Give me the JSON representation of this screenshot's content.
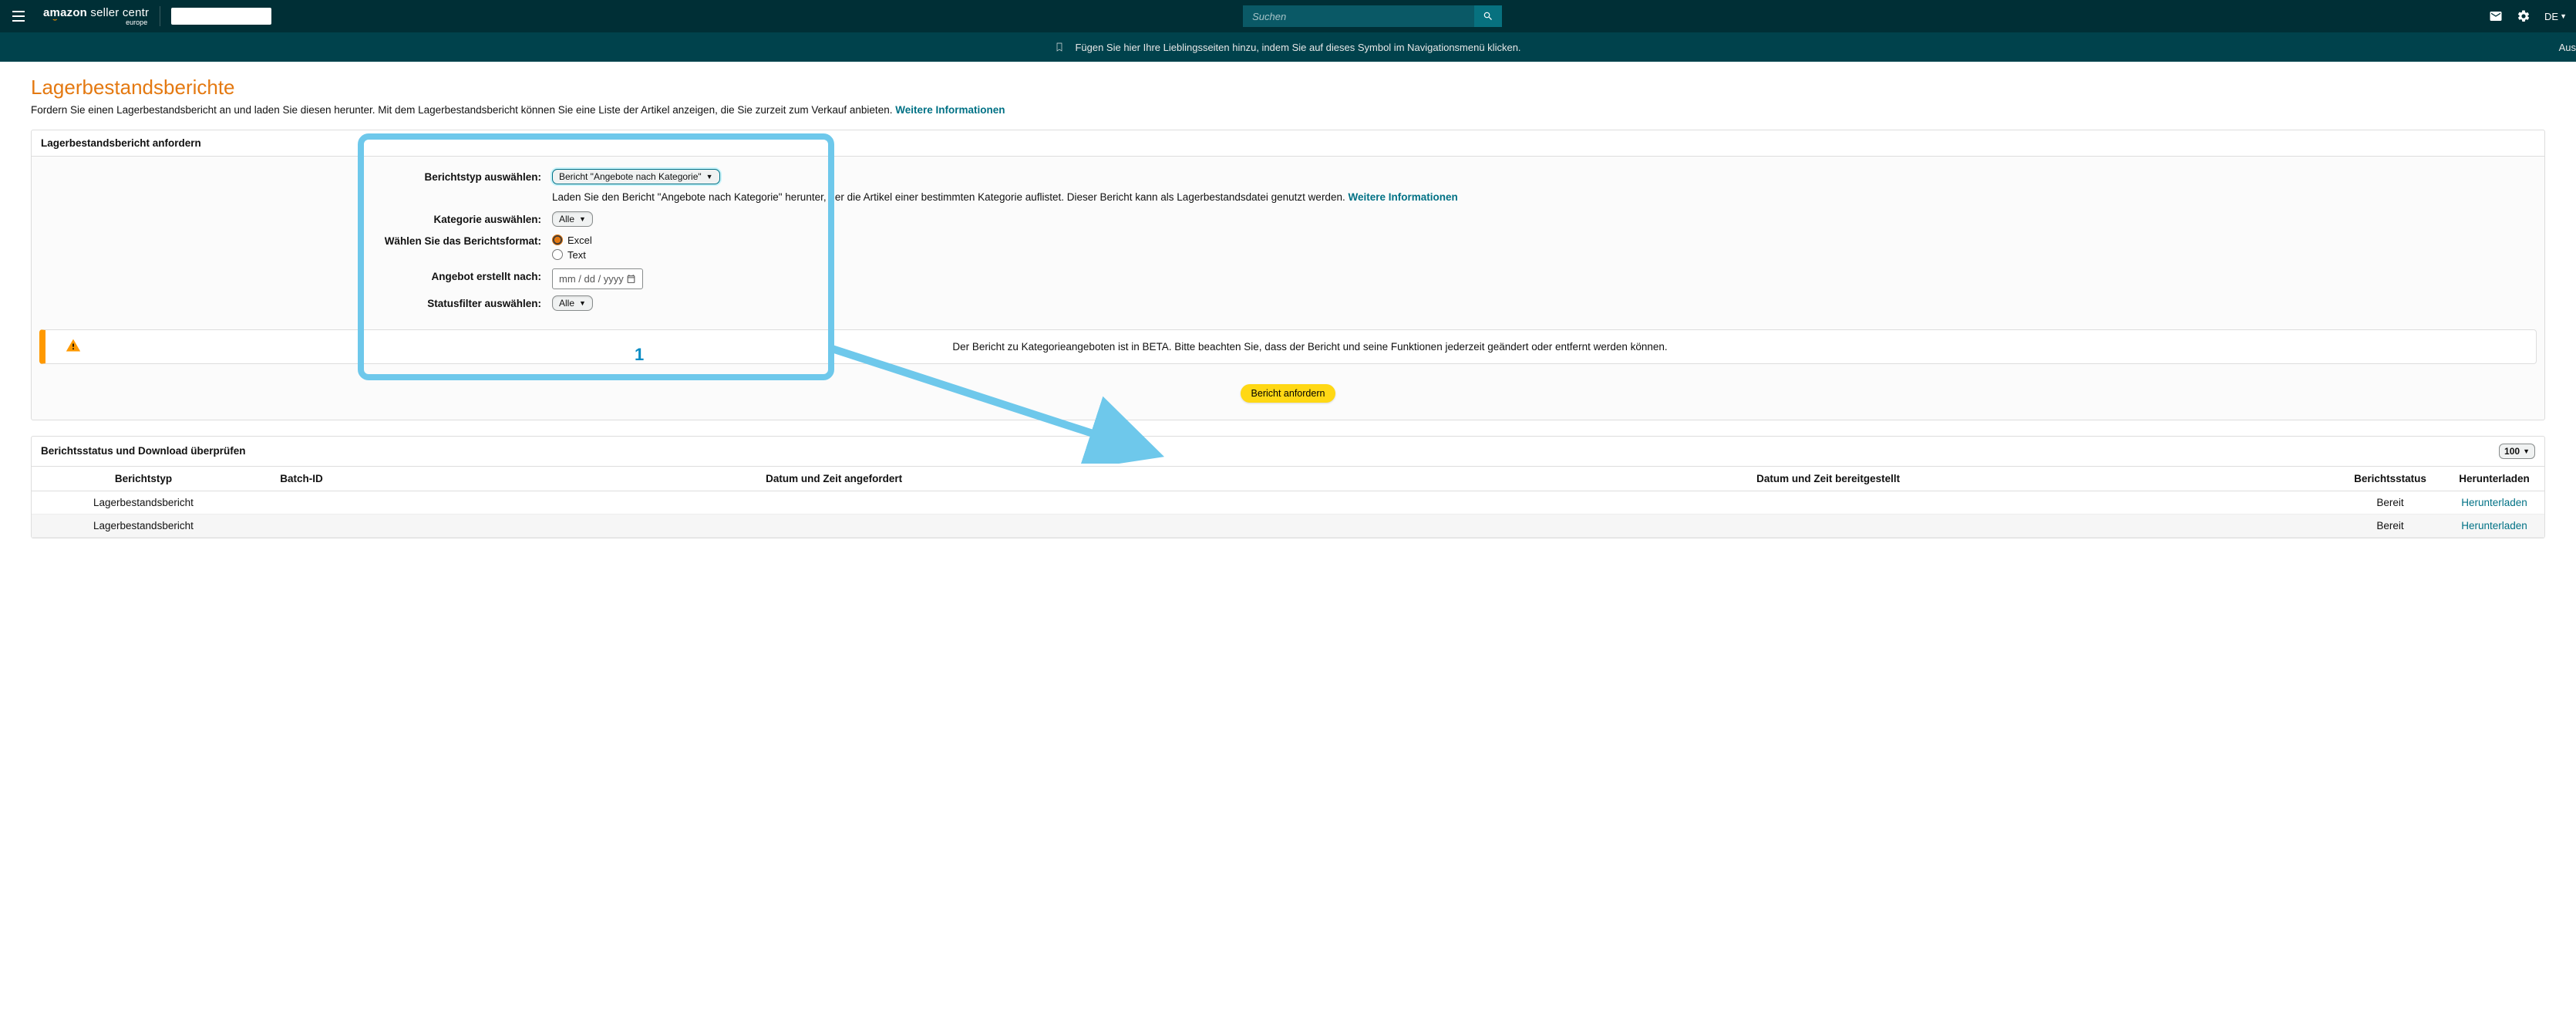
{
  "header": {
    "logo_main": "amazon seller centr",
    "logo_sub": "europe",
    "search_placeholder": "Suchen",
    "language": "DE"
  },
  "bookmark_bar": {
    "text": "Fügen Sie hier Ihre Lieblingsseiten hinzu, indem Sie auf dieses Symbol im Navigationsmenü klicken.",
    "right": "Aus"
  },
  "page": {
    "title": "Lagerbestandsberichte",
    "subtitle_pre": "Fordern Sie einen Lagerbestandsbericht an und laden Sie diesen herunter. Mit dem Lagerbestandsbericht können Sie eine Liste der Artikel anzeigen, die Sie zurzeit zum Verkauf anbieten. ",
    "subtitle_link": "Weitere Informationen"
  },
  "request_panel": {
    "header": "Lagerbestandsbericht anfordern",
    "labels": {
      "report_type": "Berichtstyp auswählen:",
      "category": "Kategorie auswählen:",
      "format": "Wählen Sie das Berichtsformat:",
      "created_after": "Angebot erstellt nach:",
      "status_filter": "Statusfilter auswählen:"
    },
    "report_type_value": "Bericht \"Angebote nach Kategorie\"",
    "report_type_desc_pre": "Laden Sie den Bericht \"Angebote nach Kategorie\" herunter, der die Artikel einer bestimmten Kategorie auflistet. Dieser Bericht kann als Lagerbestandsdatei genutzt werden. ",
    "report_type_desc_link": "Weitere Informationen",
    "category_value": "Alle",
    "format_excel": "Excel",
    "format_text": "Text",
    "date_placeholder": "mm / dd / yyyy",
    "status_value": "Alle",
    "alert": "Der Bericht zu Kategorieangeboten ist in BETA. Bitte beachten Sie, dass der Bericht und seine Funktionen jederzeit geändert oder entfernt werden können.",
    "submit": "Bericht anfordern"
  },
  "status_panel": {
    "header": "Berichtsstatus und Download überprüfen",
    "page_size": "100",
    "columns": {
      "type": "Berichtstyp",
      "batch": "Batch-ID",
      "requested": "Datum und Zeit angefordert",
      "provided": "Datum und Zeit bereitgestellt",
      "status": "Berichtsstatus",
      "download": "Herunterladen"
    },
    "rows": [
      {
        "type": "Lagerbestandsbericht",
        "batch": "",
        "requested": "",
        "provided": "",
        "status": "Bereit",
        "download": "Herunterladen"
      },
      {
        "type": "Lagerbestandsbericht",
        "batch": "",
        "requested": "",
        "provided": "",
        "status": "Bereit",
        "download": "Herunterladen"
      }
    ]
  },
  "annotation": {
    "num": "1"
  }
}
